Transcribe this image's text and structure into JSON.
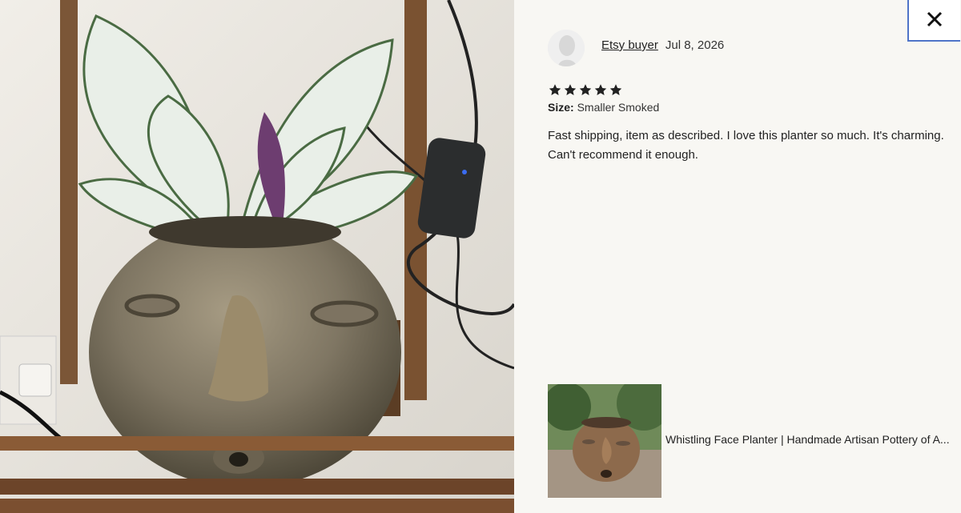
{
  "review": {
    "reviewer": "Etsy buyer",
    "date": "Jul 8, 2026",
    "rating": 5,
    "size_label": "Size:",
    "size_value": "Smaller Smoked",
    "text": "Fast shipping, item as described. I love this planter so much. It's charming. Can't recommend it enough."
  },
  "product": {
    "title": "Whistling Face Planter | Handmade Artisan Pottery of A..."
  },
  "icons": {
    "close": "close-icon",
    "avatar": "avatar-icon",
    "star": "star-icon"
  },
  "colors": {
    "panel_bg": "#f8f7f3",
    "focus_border": "#4f74c8",
    "text": "#222222"
  }
}
